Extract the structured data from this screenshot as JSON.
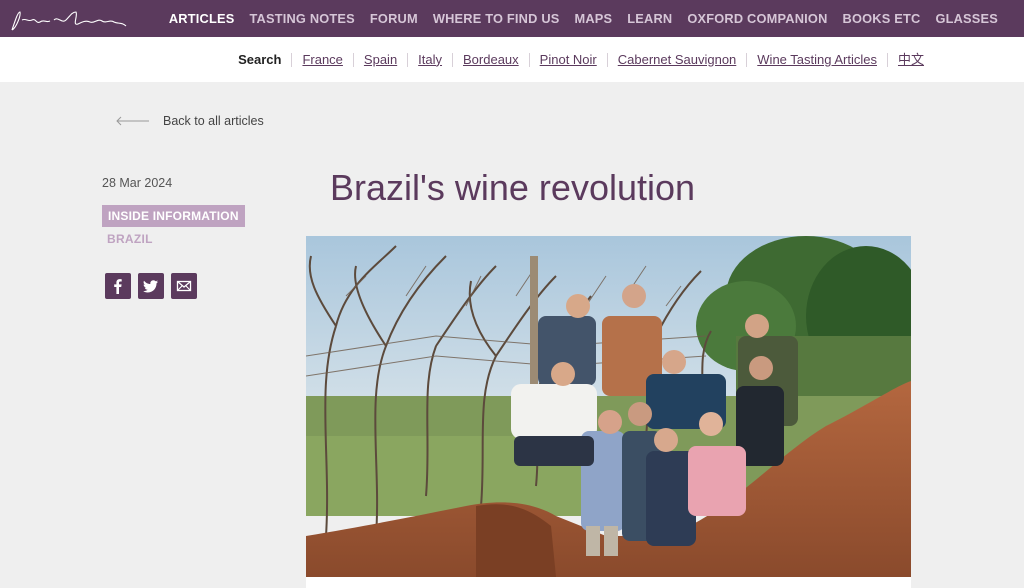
{
  "brand": {
    "logo_text": "Jancis Robinson"
  },
  "main_nav": [
    {
      "label": "ARTICLES",
      "active": true
    },
    {
      "label": "TASTING NOTES",
      "active": false
    },
    {
      "label": "FORUM",
      "active": false
    },
    {
      "label": "WHERE TO FIND US",
      "active": false
    },
    {
      "label": "MAPS",
      "active": false
    },
    {
      "label": "LEARN",
      "active": false
    },
    {
      "label": "OXFORD COMPANION",
      "active": false
    },
    {
      "label": "BOOKS ETC",
      "active": false
    },
    {
      "label": "GLASSES",
      "active": false
    }
  ],
  "sub_nav": {
    "search_label": "Search",
    "links": [
      "France",
      "Spain",
      "Italy",
      "Bordeaux",
      "Pinot Noir",
      "Cabernet Sauvignon",
      "Wine Tasting Articles",
      "中文"
    ]
  },
  "back_link": {
    "label": "Back to all articles",
    "icon": "arrow-left-icon"
  },
  "article": {
    "date": "28 Mar 2024",
    "category": "INSIDE INFORMATION",
    "tag": "BRAZIL",
    "title": "Brazil's wine revolution"
  },
  "share": [
    {
      "icon": "facebook-icon"
    },
    {
      "icon": "twitter-icon"
    },
    {
      "icon": "email-icon"
    }
  ],
  "colors": {
    "brand_purple": "#5b3a5d",
    "light_purple": "#bfa3c1",
    "page_bg": "#efefef"
  }
}
